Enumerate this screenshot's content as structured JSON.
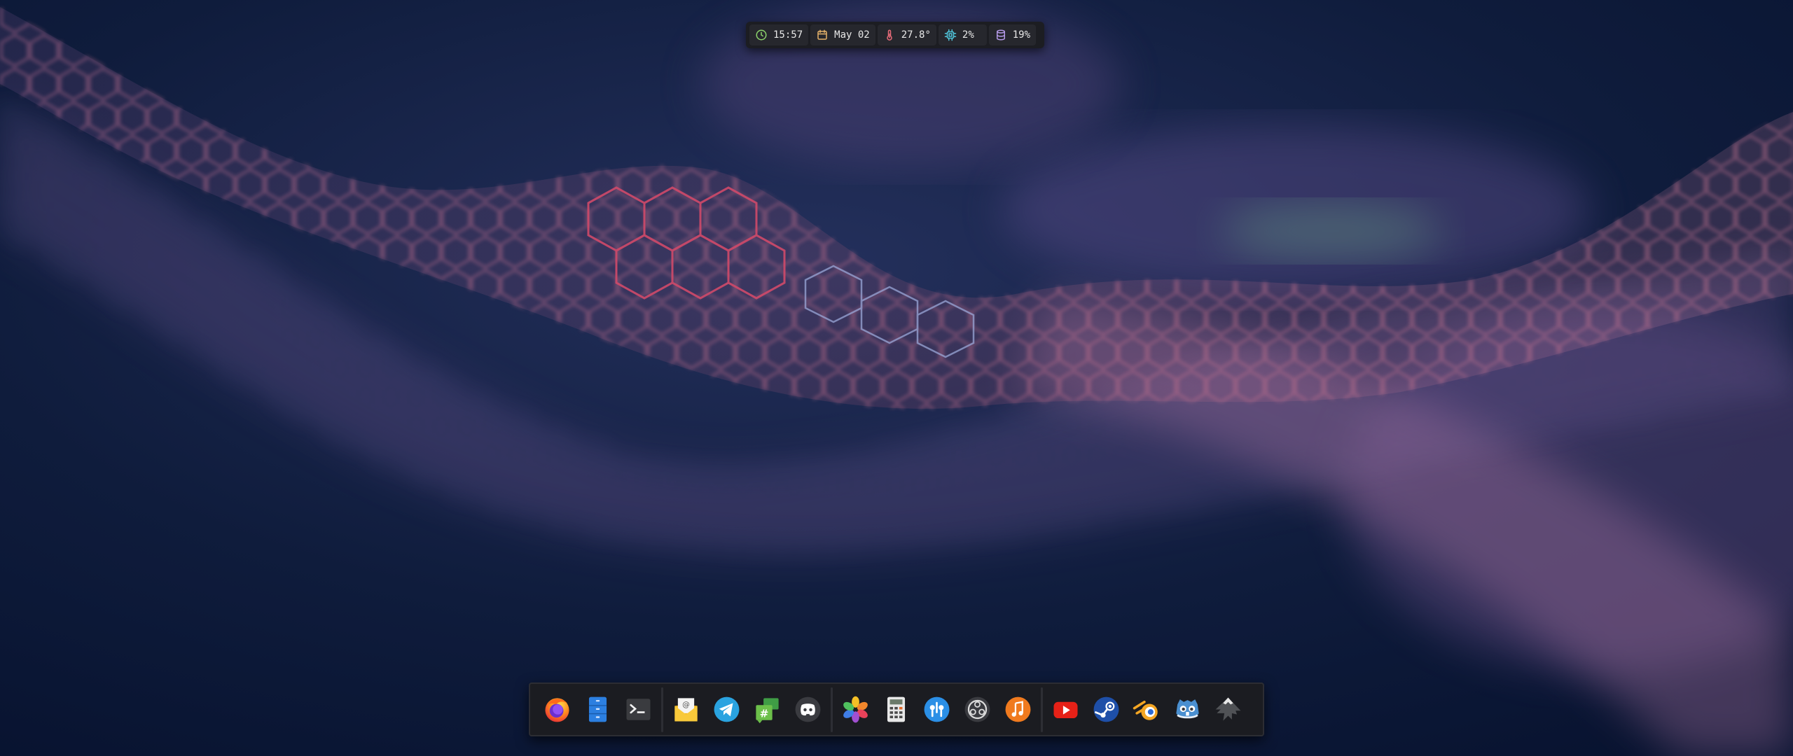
{
  "status_bar": {
    "clock": {
      "icon": "clock-icon",
      "value": "15:57",
      "color": "#8bd36b"
    },
    "date": {
      "icon": "calendar-icon",
      "value": "May 02",
      "color": "#e5b26a"
    },
    "temperature": {
      "icon": "thermometer-icon",
      "value": "27.8°",
      "color": "#e66a78"
    },
    "cpu": {
      "icon": "cpu-icon",
      "value": "2%",
      "color": "#4fc3d9"
    },
    "memory": {
      "icon": "database-icon",
      "value": "19%",
      "color": "#b59ae8"
    }
  },
  "dock": {
    "groups": [
      {
        "apps": [
          {
            "name": "firefox",
            "icon": "firefox-icon"
          },
          {
            "name": "files",
            "icon": "file-manager-icon"
          },
          {
            "name": "terminal",
            "icon": "terminal-icon"
          }
        ]
      },
      {
        "apps": [
          {
            "name": "mail",
            "icon": "mail-icon"
          },
          {
            "name": "telegram",
            "icon": "telegram-icon"
          },
          {
            "name": "hexchat",
            "icon": "hexchat-icon"
          },
          {
            "name": "discord",
            "icon": "discord-icon"
          }
        ]
      },
      {
        "apps": [
          {
            "name": "photos",
            "icon": "photos-icon"
          },
          {
            "name": "calculator",
            "icon": "calculator-icon"
          },
          {
            "name": "podcasts",
            "icon": "podcast-icon"
          },
          {
            "name": "obs-studio",
            "icon": "obs-icon"
          },
          {
            "name": "music",
            "icon": "music-icon"
          }
        ]
      },
      {
        "apps": [
          {
            "name": "youtube",
            "icon": "youtube-icon"
          },
          {
            "name": "steam",
            "icon": "steam-icon"
          },
          {
            "name": "blender",
            "icon": "blender-icon"
          },
          {
            "name": "godot",
            "icon": "godot-icon"
          },
          {
            "name": "inkscape",
            "icon": "inkscape-icon"
          }
        ]
      }
    ]
  },
  "colors": {
    "background": "#0a1632",
    "bar": "#1c1d22",
    "module": "#26272d",
    "text": "#e8e8e8"
  }
}
